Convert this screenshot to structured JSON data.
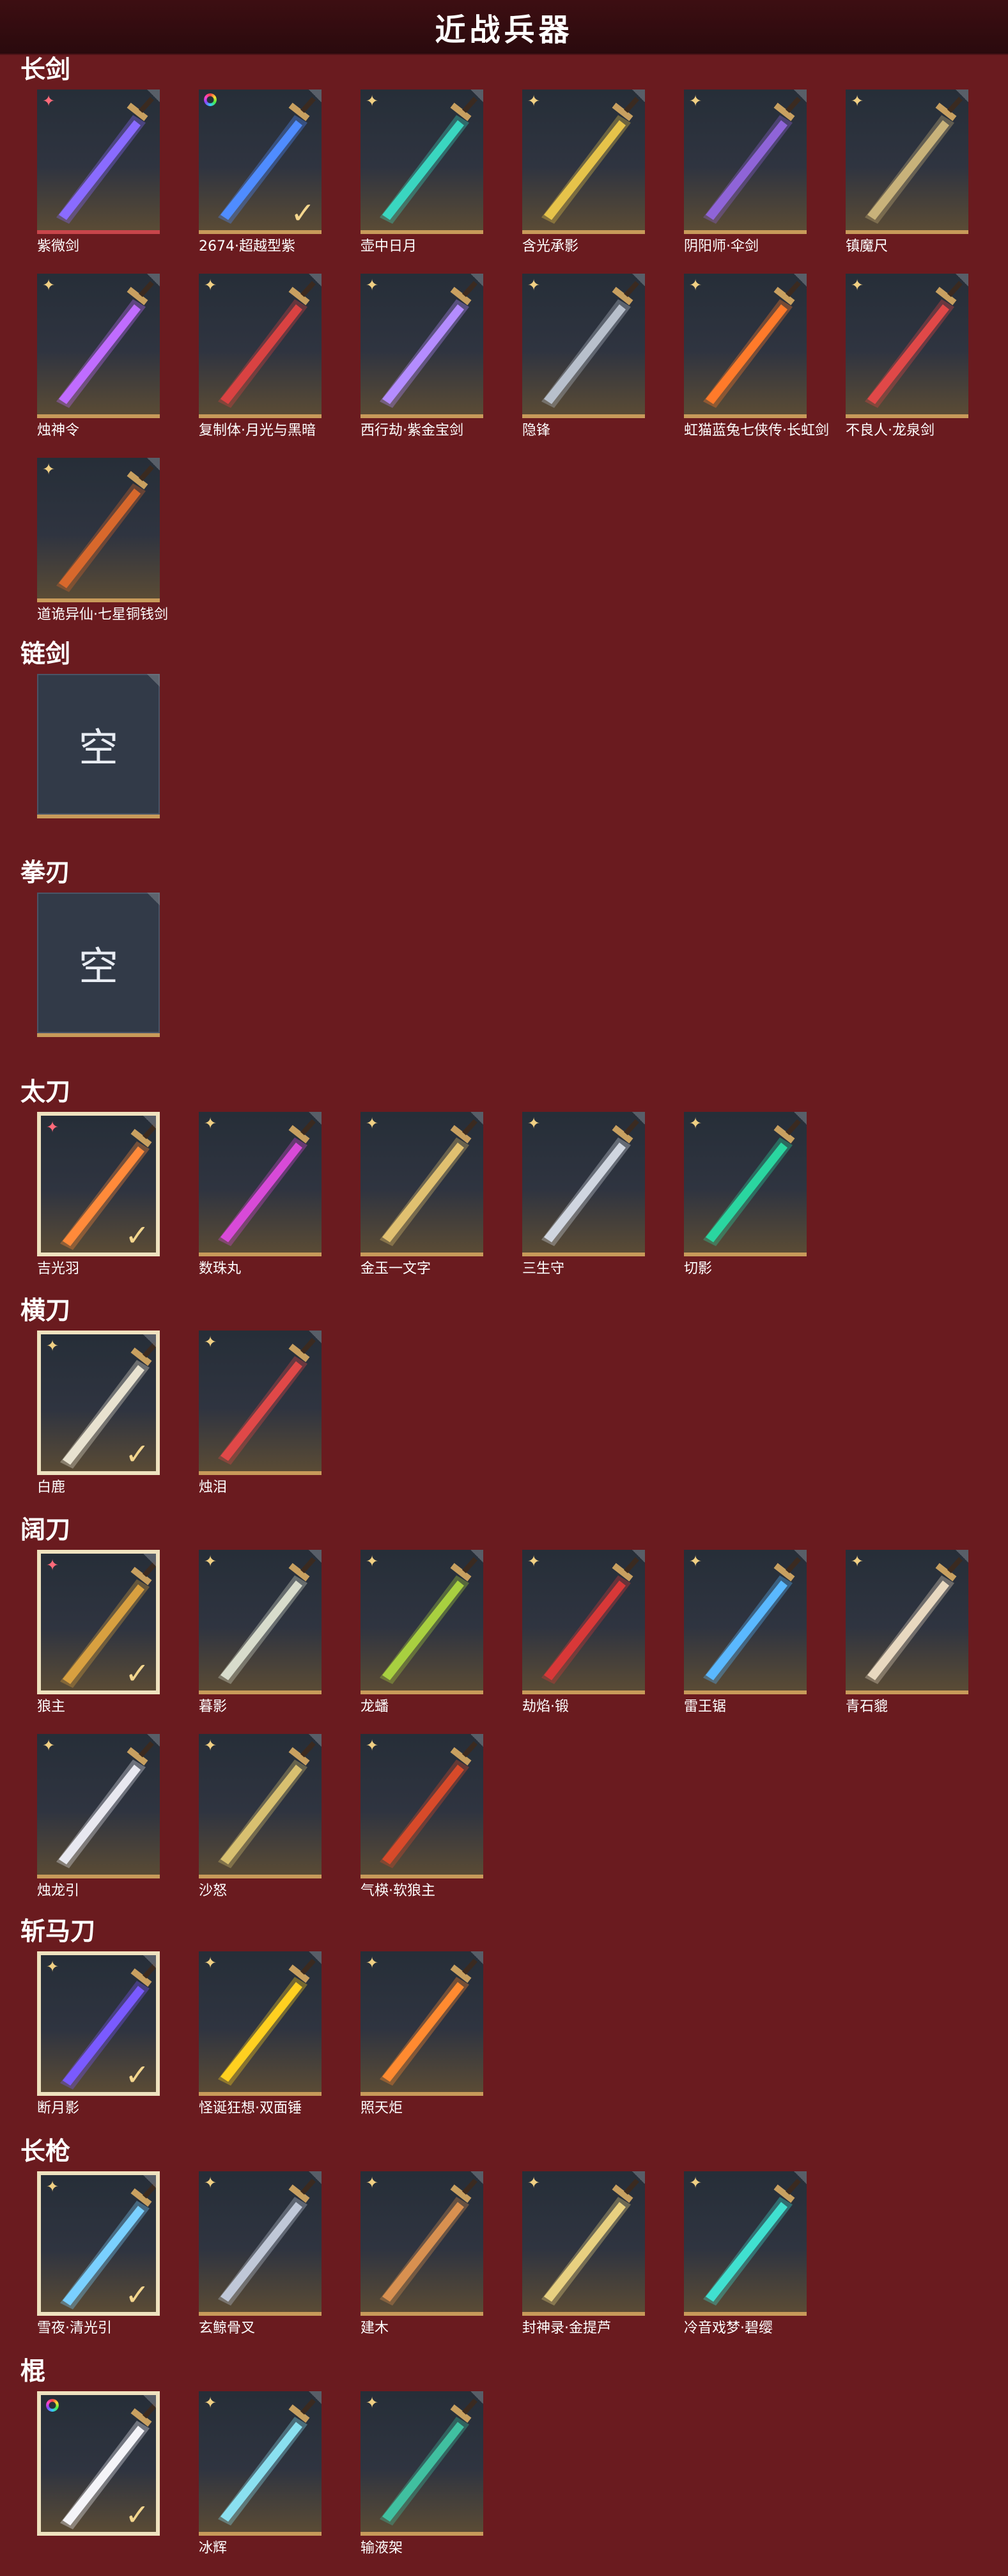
{
  "header": {
    "title": "近战兵器"
  },
  "sections": [
    {
      "id": "longsword",
      "title": "长剑",
      "items": [
        {
          "name": "紫微剑",
          "rank": "star",
          "selected": false,
          "color": "#8a6bff"
        },
        {
          "name": "2674·超越型紫",
          "rank": "ring",
          "selected": false,
          "check": true,
          "color": "#4f8cff"
        },
        {
          "name": "壶中日月",
          "rank": "diamond",
          "color": "#3ad6c0"
        },
        {
          "name": "含光承影",
          "rank": "diamond",
          "color": "#e6c34a"
        },
        {
          "name": "阴阳师·伞剑",
          "rank": "diamond",
          "color": "#8f64d8"
        },
        {
          "name": "镇魔尺",
          "rank": "diamond",
          "color": "#c8b27a"
        },
        {
          "name": "烛神令",
          "rank": "diamond",
          "color": "#c06cff"
        },
        {
          "name": "复制体·月光与黑暗",
          "rank": "diamond",
          "color": "#d94242"
        },
        {
          "name": "西行劫·紫金宝剑",
          "rank": "diamond",
          "color": "#b48cff"
        },
        {
          "name": "隐锋",
          "rank": "diamond",
          "color": "#b8c0cc"
        },
        {
          "name": "虹猫蓝兔七侠传·长虹剑",
          "rank": "diamond",
          "color": "#ff7a2a"
        },
        {
          "name": "不良人·龙泉剑",
          "rank": "diamond",
          "color": "#e04848"
        },
        {
          "name": "道诡异仙·七星铜钱剑",
          "rank": "diamond",
          "color": "#d8682c"
        }
      ]
    },
    {
      "id": "chainsword",
      "title": "链剑",
      "items": [
        {
          "name": "",
          "empty": true,
          "empty_label": "空"
        }
      ]
    },
    {
      "id": "fistblade",
      "title": "拳刃",
      "items": [
        {
          "name": "",
          "empty": true,
          "empty_label": "空"
        }
      ]
    },
    {
      "id": "tachi",
      "title": "太刀",
      "items": [
        {
          "name": "吉光羽",
          "rank": "star",
          "selected": true,
          "check": true,
          "color": "#ff8a3a"
        },
        {
          "name": "数珠丸",
          "rank": "diamond",
          "color": "#d84ad8"
        },
        {
          "name": "金玉一文字",
          "rank": "diamond",
          "color": "#e0c070"
        },
        {
          "name": "三生守",
          "rank": "diamond",
          "color": "#d0d6e0"
        },
        {
          "name": "切影",
          "rank": "diamond",
          "color": "#2ad6a0"
        }
      ]
    },
    {
      "id": "dao",
      "title": "横刀",
      "items": [
        {
          "name": "白鹿",
          "rank": "diamond",
          "selected": true,
          "check": true,
          "color": "#e8e2d0"
        },
        {
          "name": "烛泪",
          "rank": "diamond",
          "color": "#e04848"
        }
      ]
    },
    {
      "id": "broadblade",
      "title": "阔刀",
      "items": [
        {
          "name": "狼主",
          "rank": "star",
          "selected": true,
          "check": true,
          "color": "#d8a040"
        },
        {
          "name": "暮影",
          "rank": "diamond",
          "color": "#d8dccc"
        },
        {
          "name": "龙蟠",
          "rank": "diamond",
          "color": "#a8d040"
        },
        {
          "name": "劫焰·锻",
          "rank": "diamond",
          "color": "#d83838"
        },
        {
          "name": "雷王锯",
          "rank": "diamond",
          "color": "#5ab8ff"
        },
        {
          "name": "青石貔",
          "rank": "diamond",
          "color": "#e8d8c0"
        },
        {
          "name": "烛龙引",
          "rank": "diamond",
          "color": "#e8e8f0"
        },
        {
          "name": "沙怒",
          "rank": "diamond",
          "color": "#d8c070"
        },
        {
          "name": "气楧·软狼主",
          "rank": "diamond",
          "color": "#d84a2a"
        }
      ]
    },
    {
      "id": "zhanmadao",
      "title": "斩马刀",
      "items": [
        {
          "name": "断月影",
          "rank": "diamond",
          "selected": true,
          "check": true,
          "color": "#7a5aff"
        },
        {
          "name": "怪诞狂想·双面锤",
          "rank": "diamond",
          "color": "#ffd020"
        },
        {
          "name": "照天炬",
          "rank": "diamond",
          "color": "#ff8a30"
        }
      ]
    },
    {
      "id": "spear",
      "title": "长枪",
      "items": [
        {
          "name": "雪夜·清光引",
          "rank": "diamond",
          "selected": true,
          "check": true,
          "color": "#7ad0ff"
        },
        {
          "name": "玄鲸骨叉",
          "rank": "diamond",
          "color": "#c0c8d8"
        },
        {
          "name": "建木",
          "rank": "diamond",
          "color": "#d89050"
        },
        {
          "name": "封神录·金提芦",
          "rank": "diamond",
          "color": "#e8d080"
        },
        {
          "name": "冷音戏梦·碧缨",
          "rank": "diamond",
          "color": "#40e0d0"
        }
      ]
    },
    {
      "id": "staff",
      "title": "棍",
      "items": [
        {
          "name": "",
          "rank": "ring",
          "selected": true,
          "check": true,
          "color": "#f4f4f8"
        },
        {
          "name": "冰辉",
          "rank": "diamond",
          "color": "#8ae0f0"
        },
        {
          "name": "输液架",
          "rank": "diamond",
          "color": "#40c0a0"
        }
      ]
    }
  ]
}
